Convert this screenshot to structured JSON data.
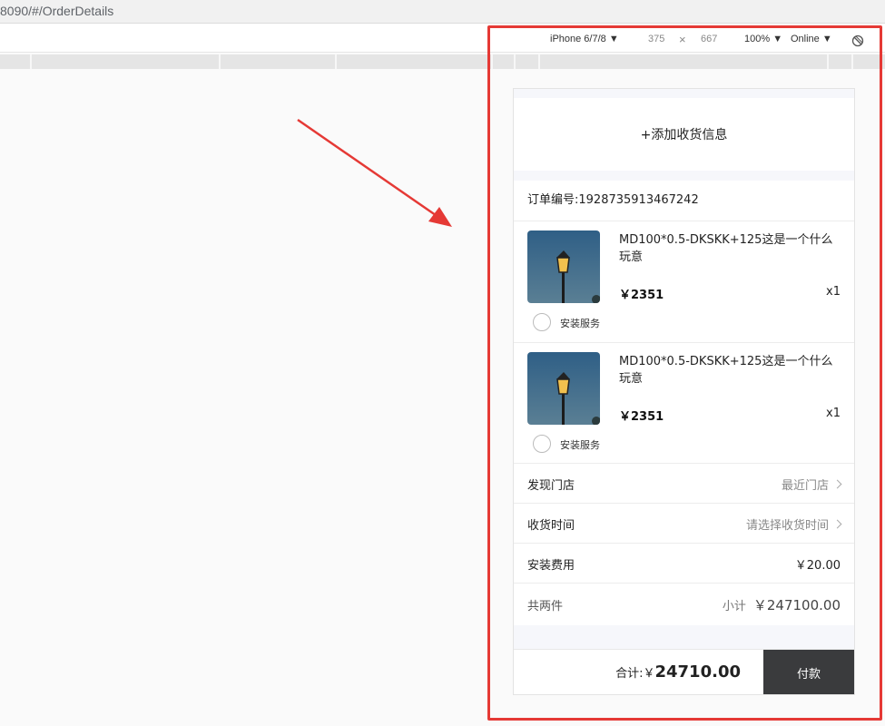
{
  "browser": {
    "url": "8090/#/OrderDetails",
    "device": "iPhone 6/7/8 ▼",
    "width": "375",
    "times": "×",
    "height": "667",
    "zoom": "100% ▼",
    "network": "Online ▼"
  },
  "colors": {
    "highlight": "#e53935",
    "pay_button": "#3a3b3d"
  },
  "address": {
    "label": "+添加收货信息"
  },
  "order": {
    "number_label": "订单编号:1928735913467242"
  },
  "items": [
    {
      "name": "MD100*0.5-DKSKK+125这是一个什么玩意",
      "price": "￥2351",
      "qty": "x1",
      "service": "安装服务",
      "thumb": "street-lamp-image"
    },
    {
      "name": "MD100*0.5-DKSKK+125这是一个什么玩意",
      "price": "￥2351",
      "qty": "x1",
      "service": "安装服务",
      "thumb": "street-lamp-image"
    }
  ],
  "rows": {
    "store": {
      "label": "发现门店",
      "value": "最近门店"
    },
    "delivery": {
      "label": "收货时间",
      "value": "请选择收货时间"
    },
    "install_fee": {
      "label": "安装费用",
      "value": "￥20.00"
    },
    "summary": {
      "label": "共两件",
      "subtotal_label": "小计",
      "subtotal_value": "￥247100.00"
    }
  },
  "footer": {
    "total_label": "合计:￥",
    "total_value": "24710.00",
    "pay_label": "付款"
  }
}
